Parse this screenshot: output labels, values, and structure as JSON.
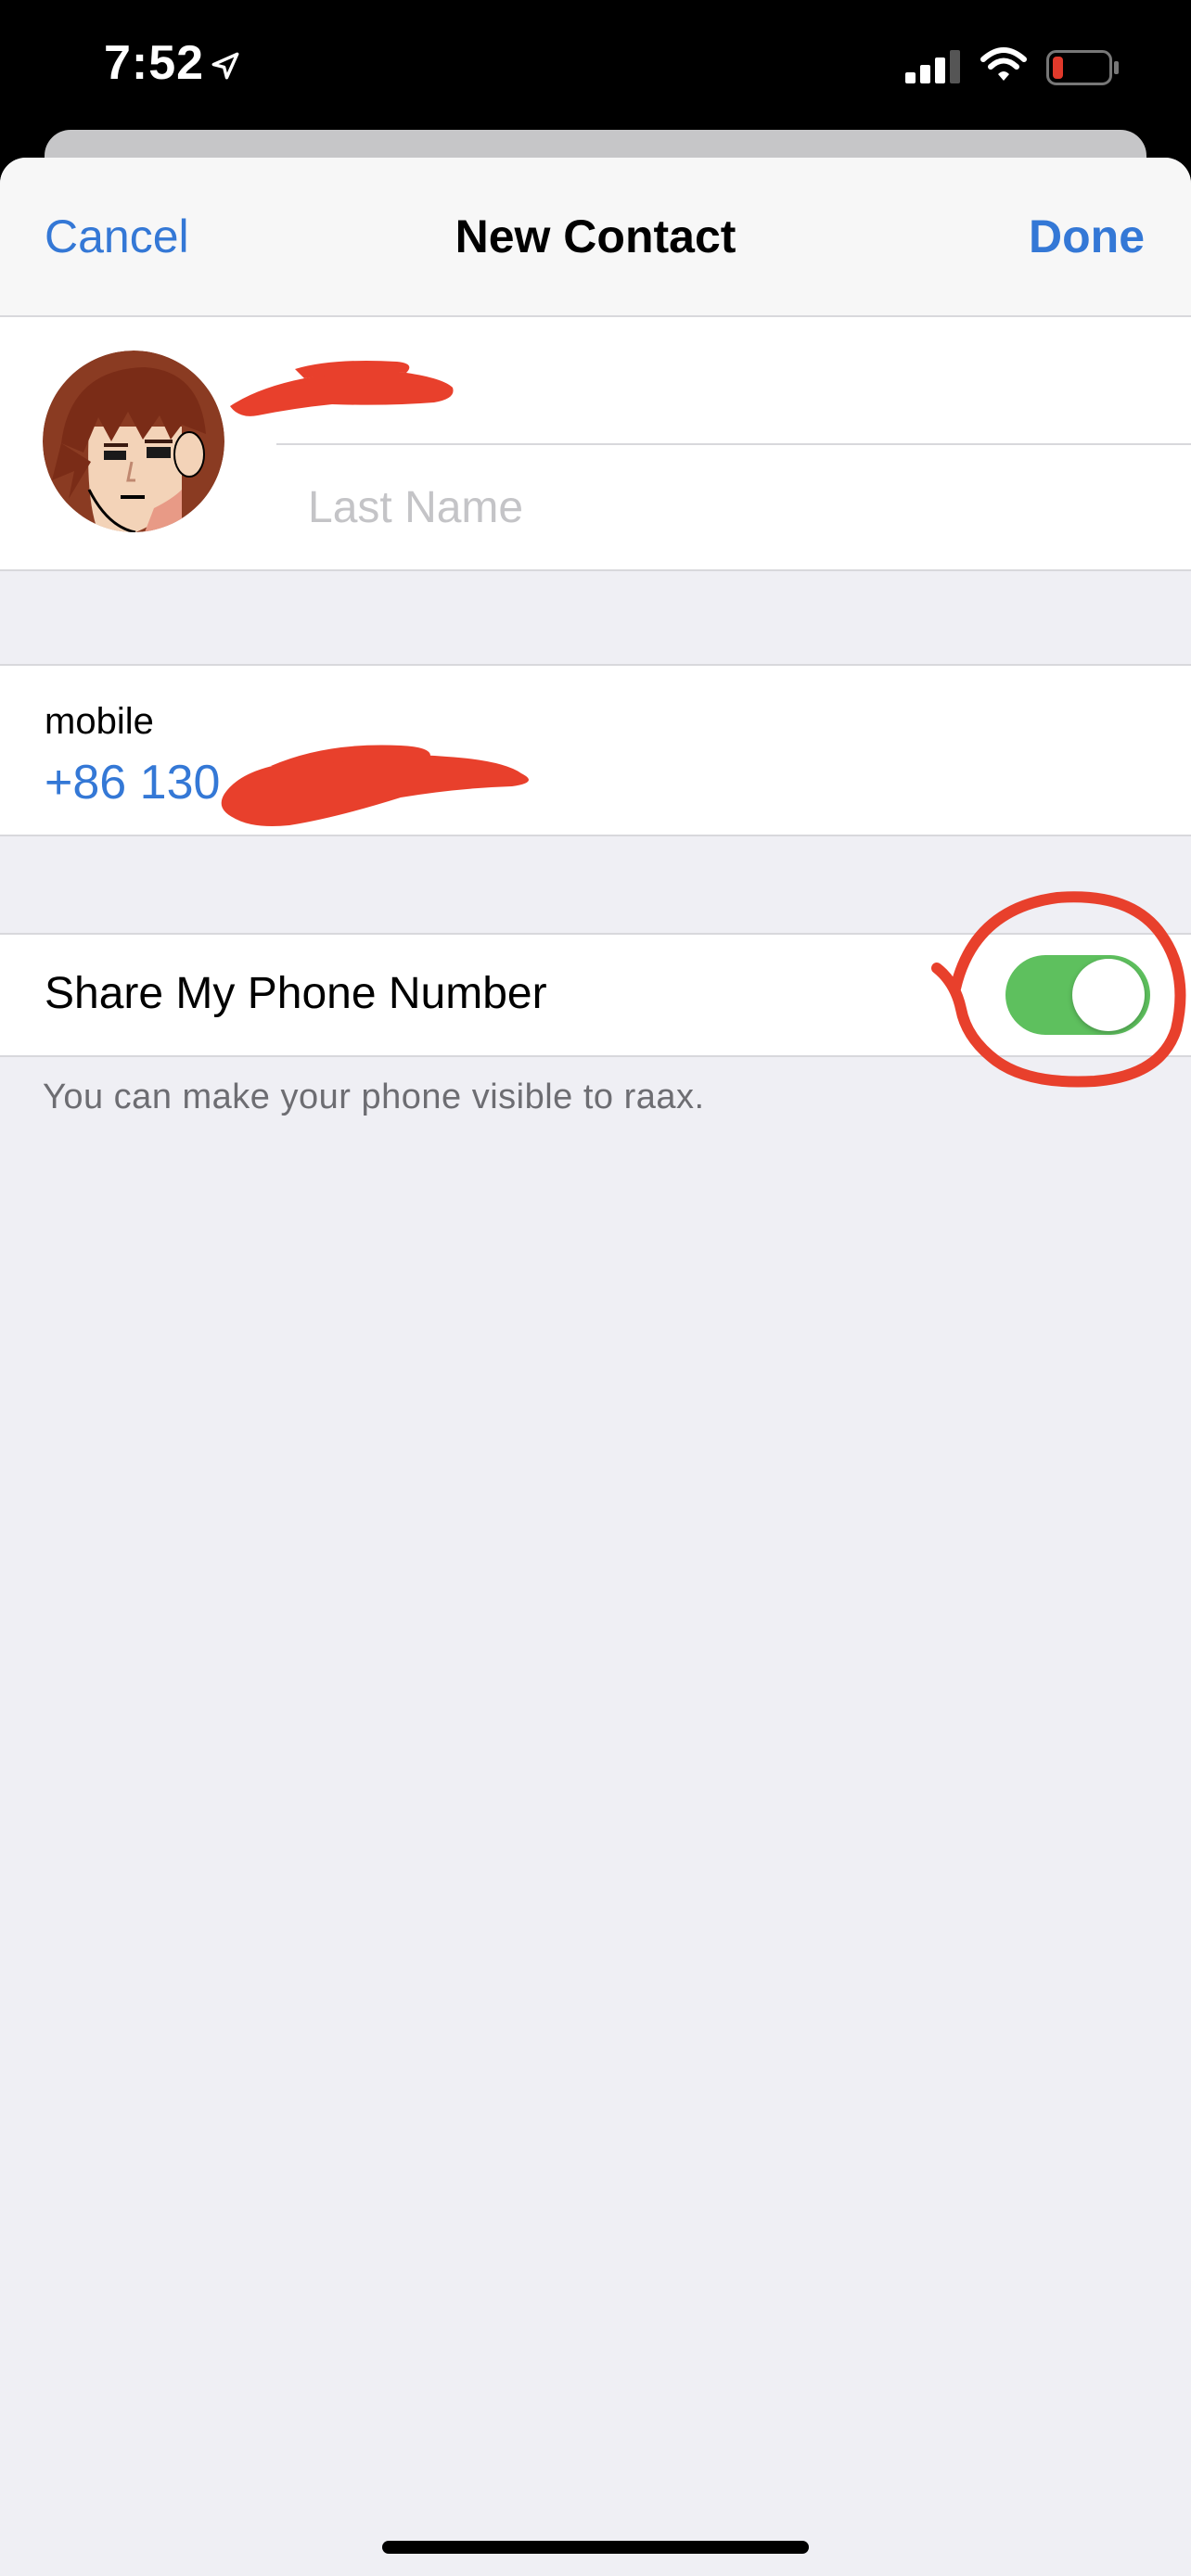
{
  "status_bar": {
    "time": "7:52",
    "icons": [
      "location-arrow-icon",
      "cellular-signal-icon",
      "wifi-icon",
      "battery-low-icon"
    ],
    "battery_color": "#e0392b"
  },
  "nav": {
    "cancel_label": "Cancel",
    "title": "New Contact",
    "done_label": "Done"
  },
  "name_section": {
    "first_name": "",
    "last_name_placeholder": "Last Name",
    "last_name_value": ""
  },
  "phone": {
    "label": "mobile",
    "value_visible": "+86 130"
  },
  "share": {
    "label": "Share My Phone Number",
    "enabled": true,
    "footer": "You can make your phone visible to raax."
  },
  "colors": {
    "accent": "#3478d6",
    "toggle_on": "#5ec05e",
    "annotation_red": "#e8402c",
    "background": "#efeff4"
  }
}
